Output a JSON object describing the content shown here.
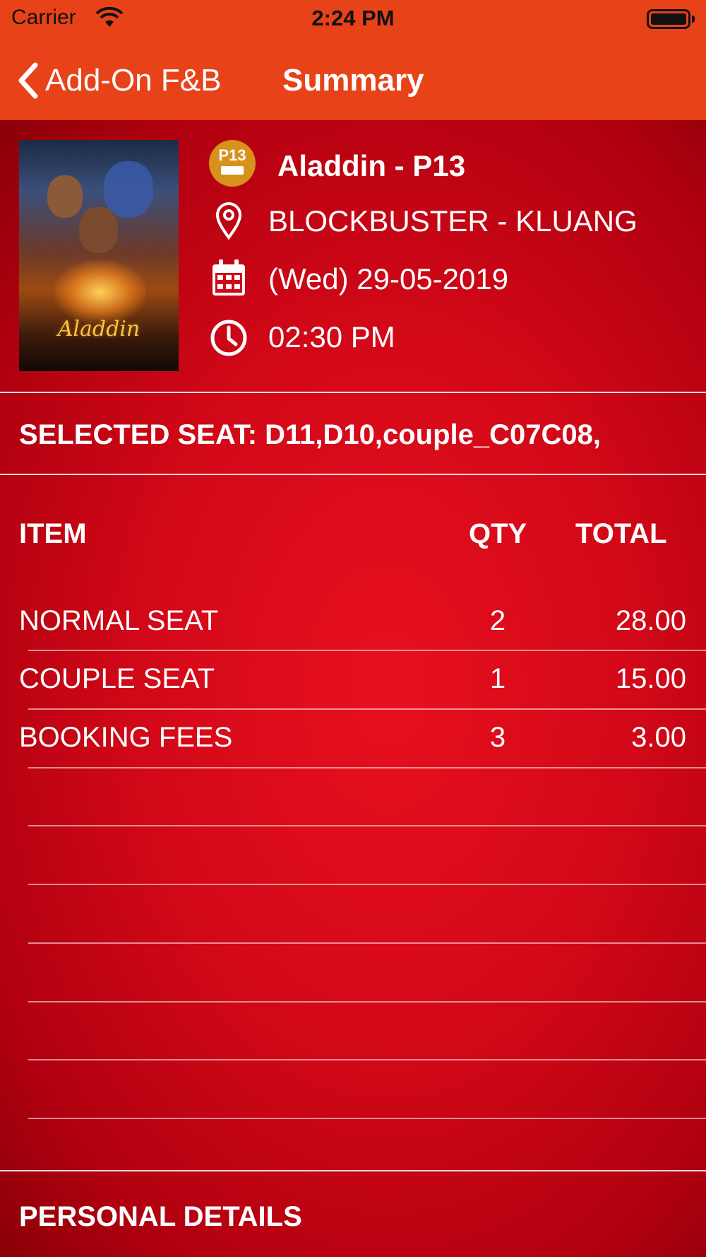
{
  "status_bar": {
    "carrier": "Carrier",
    "time": "2:24 PM"
  },
  "nav": {
    "back_label": "Add-On F&B",
    "title": "Summary"
  },
  "colors": {
    "nav_bar": "#e84218",
    "background": "#d20818",
    "rating_badge": "#d8911c"
  },
  "movie": {
    "poster_title": "Aladdin",
    "rating": "P13",
    "title": "Aladdin - P13",
    "cinema": "BLOCKBUSTER - KLUANG",
    "date": "(Wed) 29-05-2019",
    "time": "02:30 PM"
  },
  "seats": {
    "text": "SELECTED SEAT: D11,D10,couple_C07C08,"
  },
  "table": {
    "headers": {
      "item": "ITEM",
      "qty": "QTY",
      "total": "TOTAL"
    },
    "rows": [
      {
        "item": "NORMAL SEAT",
        "qty": "2",
        "total": "28.00"
      },
      {
        "item": "COUPLE SEAT",
        "qty": "1",
        "total": "15.00"
      },
      {
        "item": "BOOKING FEES",
        "qty": "3",
        "total": "3.00"
      }
    ]
  },
  "personal_details": {
    "title": "PERSONAL DETAILS"
  }
}
